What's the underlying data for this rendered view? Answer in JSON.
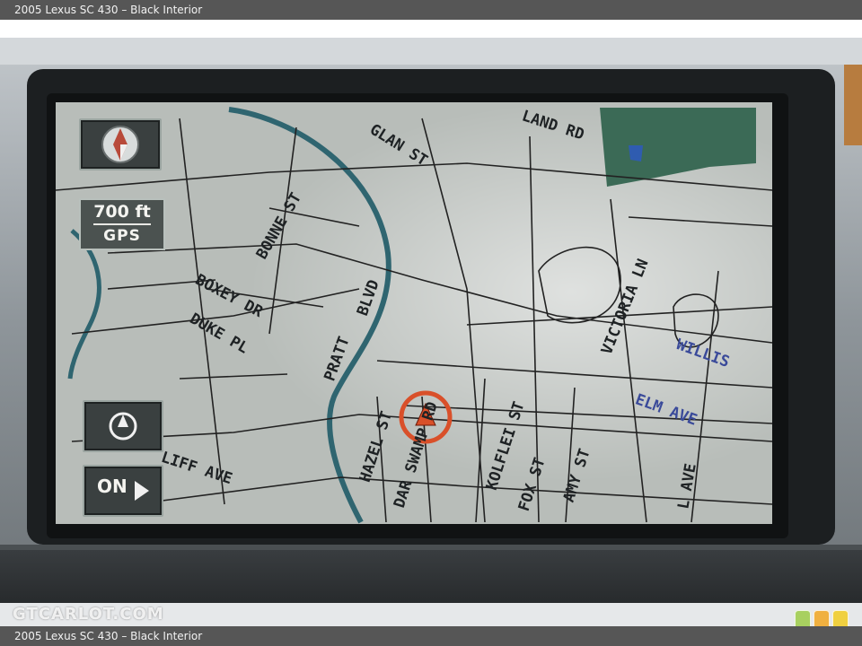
{
  "caption": {
    "title": "2005 Lexus SC 430",
    "separator": " – ",
    "subtitle": "Black Interior"
  },
  "map": {
    "scale_distance": "700 ft",
    "scale_mode": "GPS",
    "toggle_label": "ON",
    "street_labels": [
      "GLAN ST",
      "LAND RD",
      "BONNE ST",
      "BOXEY DR",
      "DUKE PL",
      "BLVD",
      "PRATT",
      "VICTORIA LN",
      "WILLIS",
      "ELM AVE",
      "HAZEL ST",
      "DAR SWAMP RD",
      "KOLFLEI ST",
      "FOX ST",
      "AMY ST",
      "L AVE",
      "LIFF AVE"
    ]
  },
  "watermark": {
    "text": "GTCARLOT.COM",
    "dot_colors": [
      "#a8d060",
      "#f0b040",
      "#f0d040"
    ]
  },
  "colors": {
    "caption_bg": "#565656",
    "map_bg": "#b8bdb9",
    "road": "#222222",
    "river": "#2f6570",
    "position_marker": "#d9502a"
  }
}
